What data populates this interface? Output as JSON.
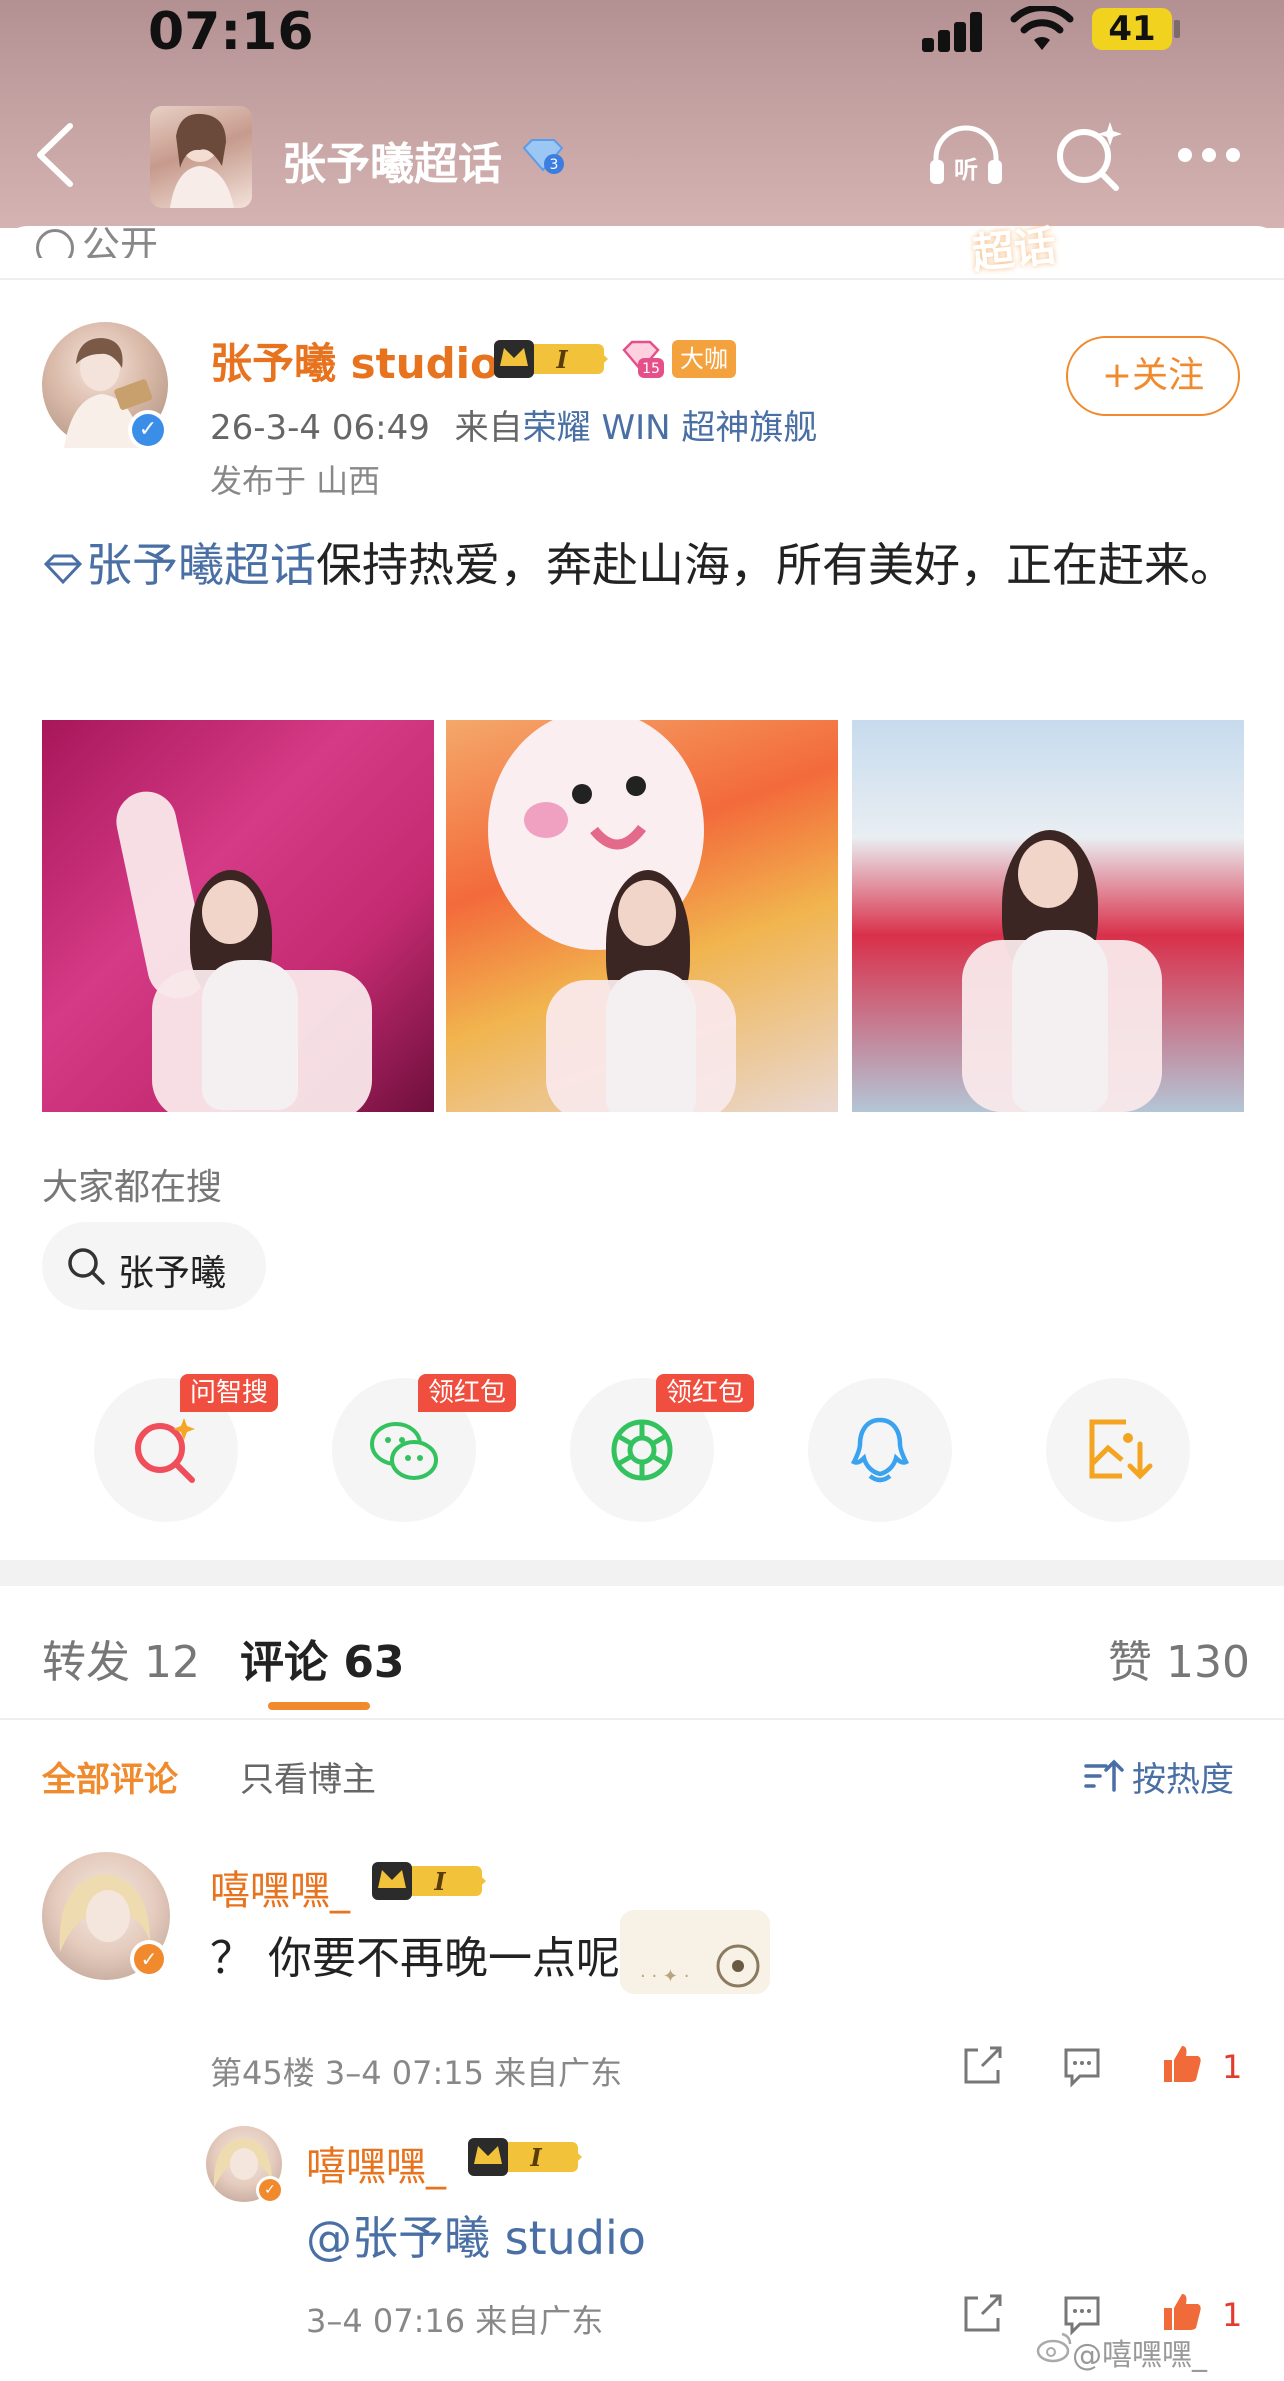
{
  "status_bar": {
    "time": "07:16",
    "battery": "41"
  },
  "header": {
    "title": "张予曦超话",
    "listen_label": "听"
  },
  "visibility": {
    "label": "公开",
    "chaohua_tag": "超话"
  },
  "post": {
    "author": "张予曦 studio",
    "level_badge": "I",
    "member_level": "15",
    "tag": "大咖",
    "follow_label": "+关注",
    "time": "26-3-4 06:49",
    "from_prefix": "来自",
    "device": "荣耀 WIN 超神旗舰",
    "location": "发布于 山西",
    "topic": "张予曦超话",
    "text": "保持热爱，奔赴山海，所有美好，正在赶来。"
  },
  "search": {
    "label": "大家都在搜",
    "chip": "张予曦"
  },
  "share": {
    "items": [
      {
        "icon": "ai-search-icon",
        "tag": "问智搜",
        "color": "#f04e5a"
      },
      {
        "icon": "wechat-icon",
        "tag": "领红包",
        "color": "#34c25f"
      },
      {
        "icon": "moments-icon",
        "tag": "领红包",
        "color": "#34c25f"
      },
      {
        "icon": "qq-icon",
        "tag": "",
        "color": "#3aa3f0"
      },
      {
        "icon": "save-image-icon",
        "tag": "",
        "color": "#f3a421"
      }
    ]
  },
  "tabs": {
    "repost": "转发 12",
    "comment": "评论 63",
    "like": "赞 130"
  },
  "filters": {
    "all": "全部评论",
    "owner_only": "只看博主",
    "sort": "按热度"
  },
  "comment": {
    "user": "嘻嘿嘿_",
    "level_badge": "I",
    "text": "？ 你要不再晚一点呢？",
    "meta": "第45楼 3–4 07:15 来自广东",
    "likes": "1"
  },
  "reply": {
    "user": "嘻嘿嘿_",
    "level_badge": "I",
    "text": "@张予曦 studio",
    "meta": "3–4 07:16 来自广东",
    "likes": "1"
  },
  "watermark": "@嘻嘿嘿_",
  "colors": {
    "accent": "#f08a2d",
    "link": "#4a6fa5",
    "like": "#e53a2e"
  }
}
